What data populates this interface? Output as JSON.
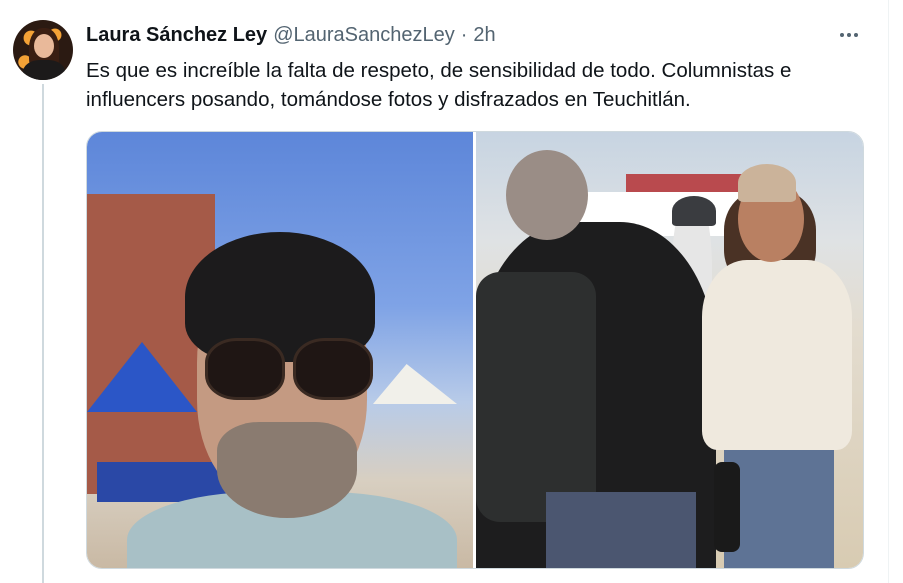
{
  "tweet": {
    "author_name": "Laura Sánchez Ley",
    "author_handle": "@LauraSanchezLey",
    "separator": "·",
    "time": "2h",
    "text": "Es que es increíble la falta de respeto, de sensibilidad de todo. Columnistas e influencers posando, tomándose fotos y disfrazados en Teuchitlán."
  },
  "icons": {
    "more": "more-horizontal-icon"
  },
  "colors": {
    "name": "#0f1419",
    "secondary": "#536471",
    "thread_line": "#cfd9de"
  }
}
